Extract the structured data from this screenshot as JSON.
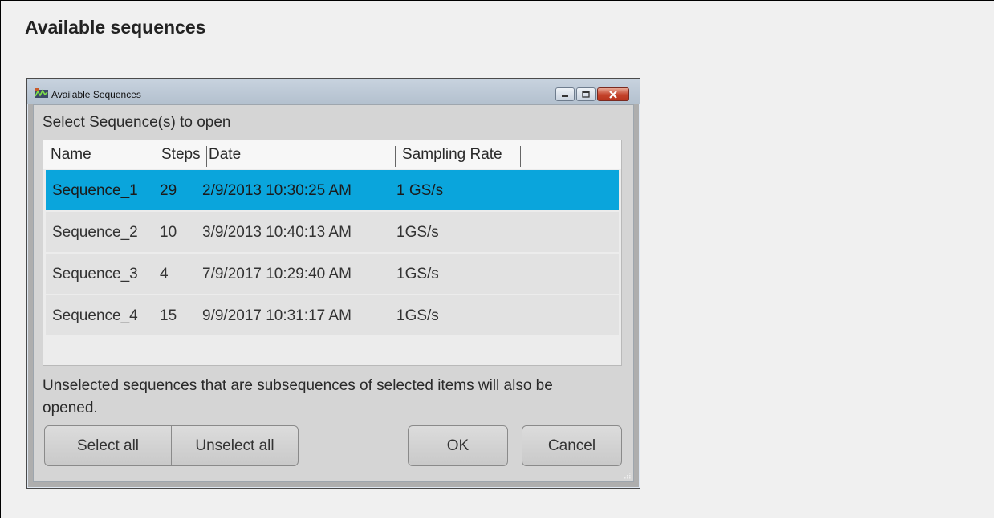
{
  "page": {
    "heading": "Available sequences"
  },
  "window": {
    "title": "Available Sequences",
    "prompt": "Select Sequence(s) to open",
    "columns": [
      "Name",
      "Steps",
      "Date",
      "Sampling Rate"
    ],
    "rows": [
      {
        "name": "Sequence_1",
        "steps": "29",
        "date": "2/9/2013 10:30:25 AM",
        "rate": "1 GS/s",
        "selected": true
      },
      {
        "name": "Sequence_2",
        "steps": "10",
        "date": "3/9/2013 10:40:13 AM",
        "rate": "1GS/s",
        "selected": false
      },
      {
        "name": "Sequence_3",
        "steps": "4",
        "date": "7/9/2017 10:29:40 AM",
        "rate": "1GS/s",
        "selected": false
      },
      {
        "name": "Sequence_4",
        "steps": "15",
        "date": "9/9/2017 10:31:17 AM",
        "rate": "1GS/s",
        "selected": false
      }
    ],
    "note": "Unselected sequences that are subsequences of selected items will also be opened.",
    "buttons": {
      "select_all": "Select all",
      "unselect_all": "Unselect all",
      "ok": "OK",
      "cancel": "Cancel"
    }
  },
  "colors": {
    "selected_row": "#0aa5dc",
    "titlebar": "#c0ccda",
    "close_button": "#c4432b"
  }
}
